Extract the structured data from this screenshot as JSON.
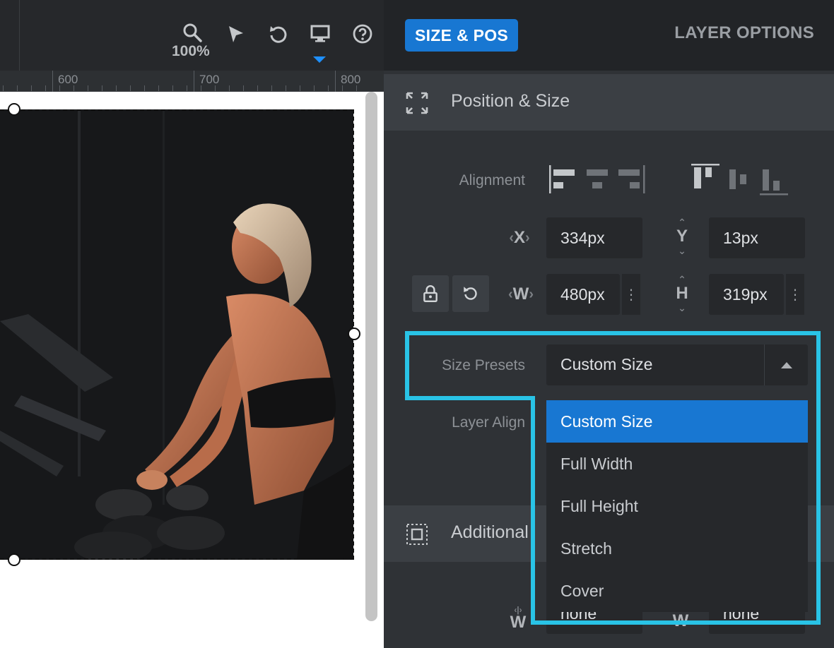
{
  "toolbar": {
    "zoom_level": "100%",
    "icons": [
      "search-icon",
      "pointer-icon",
      "undo-icon",
      "desktop-icon",
      "help-icon"
    ],
    "accent_color": "#1e90ff"
  },
  "ruler": {
    "labels": [
      "600",
      "700",
      "800"
    ]
  },
  "panel": {
    "tabs": {
      "size_pos": "SIZE & POS",
      "layer_options": "LAYER OPTIONS"
    },
    "position_size": {
      "title": "Position & Size",
      "alignment_label": "Alignment",
      "x_glyph": "X",
      "y_glyph": "Y",
      "w_glyph": "W",
      "h_glyph": "H",
      "x_value": "334px",
      "y_value": "13px",
      "w_value": "480px",
      "h_value": "319px",
      "size_presets_label": "Size Presets",
      "size_presets_value": "Custom Size",
      "layer_align_label": "Layer Align"
    },
    "dropdown": {
      "options": [
        "Custom Size",
        "Full Width",
        "Full Height",
        "Stretch",
        "Cover"
      ],
      "selected": "Custom Size"
    },
    "additional": {
      "title": "Additional",
      "min_w_value": "none",
      "max_w_value": "none",
      "w_glyph": "W"
    },
    "colors": {
      "primary": "#1877d2",
      "highlight": "#29c3e6"
    }
  }
}
